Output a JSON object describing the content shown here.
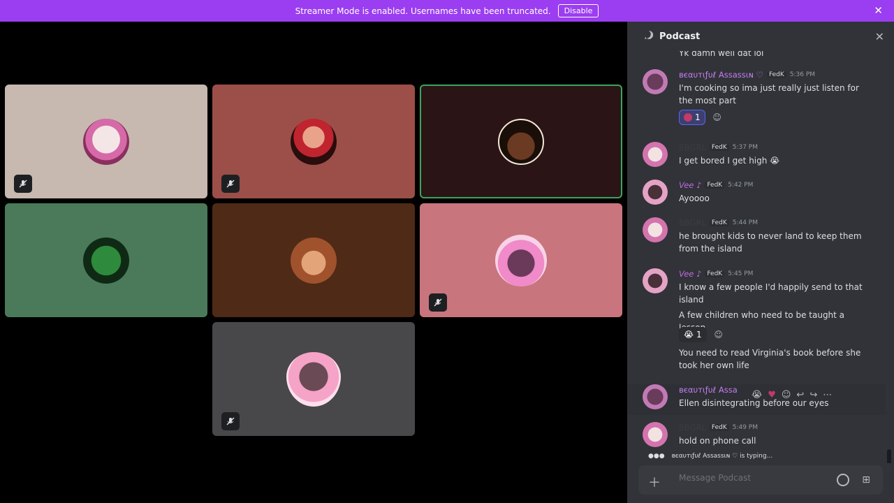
{
  "banner": {
    "text": "Streamer Mode is enabled. Usernames have been truncated.",
    "disable_label": "Disable"
  },
  "channel": {
    "title": "Podcast"
  },
  "badge_label": "FedK",
  "messages": [
    {
      "author": "",
      "author_color": "#dbdee1",
      "time": "",
      "lines": [
        "Yk damn well dat lol"
      ]
    },
    {
      "author": "ʙєαυтιƒυℓ Assassιɴ ♡",
      "author_color": "#c47cf0",
      "time": "5:36 PM",
      "lines": [
        "I'm cooking so ima just really just listen for the most part"
      ],
      "reaction_count": "1"
    },
    {
      "author": "BBGRL",
      "author_color": "#3a3c42",
      "time": "5:37 PM",
      "lines": [
        "I get bored I get high 😭"
      ]
    },
    {
      "author": "Vee ♪",
      "author_color": "#c06ae0",
      "time": "5:42 PM",
      "lines": [
        "Ayoooo"
      ]
    },
    {
      "author": "BBGRL",
      "author_color": "#3a3c42",
      "time": "5:44 PM",
      "lines": [
        "he brought kids to never land to keep them from the island"
      ]
    },
    {
      "author": "Vee ♪",
      "author_color": "#c06ae0",
      "time": "5:45 PM",
      "lines": [
        "I know a few people I'd happily send to that island",
        "A few children who need to be taught a lesson"
      ],
      "reaction_emoji": "😭",
      "reaction_count": "1",
      "followup": "You need to read Virginia's book before she took her own life"
    },
    {
      "author": "ʙєαυтιƒυℓ Assa",
      "author_color": "#c47cf0",
      "time": "",
      "lines": [
        "Ellen disintegrating before our eyes"
      ]
    },
    {
      "author": "BBGRL",
      "author_color": "#3a3c42",
      "time": "5:49 PM",
      "lines": [
        "hold on phone call"
      ]
    }
  ],
  "typing": {
    "text": "ʙєαυтιƒυℓ Assassιɴ ♡ is typing..."
  },
  "composer": {
    "placeholder": "Message Podcast"
  },
  "colors": {
    "banner": "#9b3df0",
    "panel": "#313338",
    "speaking_outline": "#3ba55d"
  }
}
